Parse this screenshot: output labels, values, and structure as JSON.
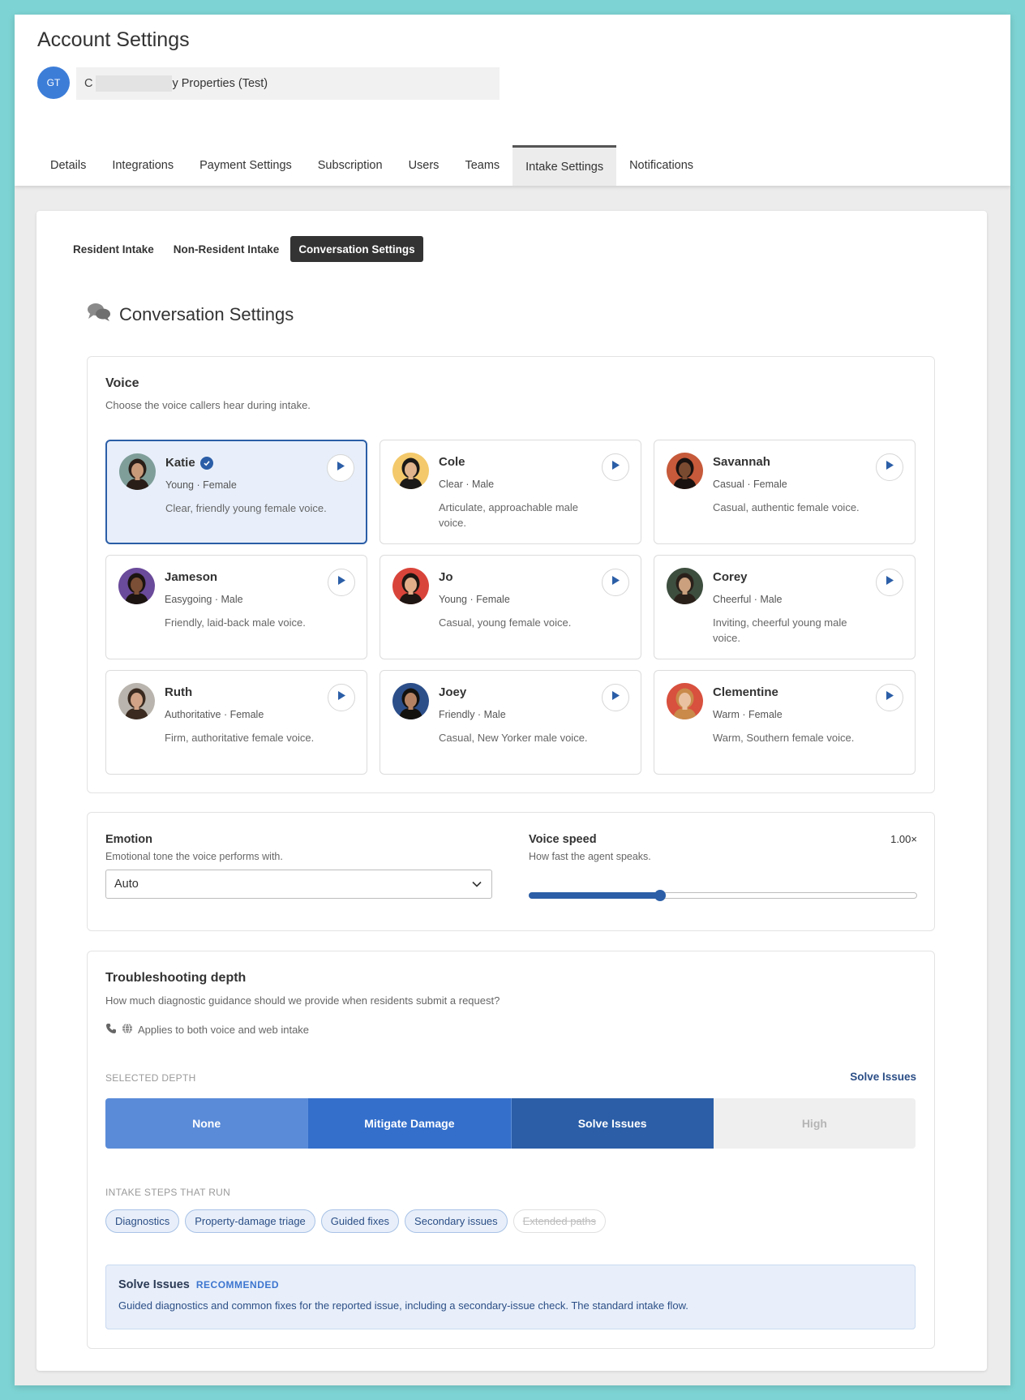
{
  "header": {
    "title": "Account Settings",
    "avatar_initials": "GT",
    "account_prefix": "C",
    "account_suffix": "y Properties (Test)"
  },
  "tabs": [
    {
      "label": "Details"
    },
    {
      "label": "Integrations"
    },
    {
      "label": "Payment Settings"
    },
    {
      "label": "Subscription"
    },
    {
      "label": "Users"
    },
    {
      "label": "Teams"
    },
    {
      "label": "Intake Settings",
      "active": true
    },
    {
      "label": "Notifications"
    }
  ],
  "subtabs": [
    {
      "label": "Resident Intake"
    },
    {
      "label": "Non-Resident Intake"
    },
    {
      "label": "Conversation Settings",
      "active": true
    }
  ],
  "section": {
    "title": "Conversation Settings",
    "icon": "chat-bubbles-icon"
  },
  "voice": {
    "title": "Voice",
    "subtitle": "Choose the voice callers hear during intake.",
    "selected": "Katie",
    "voices": [
      {
        "name": "Katie",
        "meta": "Young · Female",
        "desc": "Clear, friendly young female voice.",
        "skin": "#c99a7a",
        "hair": "#2a1e18",
        "bg": "#7f9e9a"
      },
      {
        "name": "Cole",
        "meta": "Clear · Male",
        "desc": "Articulate, approachable male voice.",
        "skin": "#e0b48c",
        "hair": "#1c1a18",
        "bg": "#f3c96b"
      },
      {
        "name": "Savannah",
        "meta": "Casual · Female",
        "desc": "Casual, authentic female voice.",
        "skin": "#7a4a30",
        "hair": "#1a1210",
        "bg": "#c65a3a"
      },
      {
        "name": "Jameson",
        "meta": "Easygoing · Male",
        "desc": "Friendly, laid-back male voice.",
        "skin": "#7b4f35",
        "hair": "#1b1410",
        "bg": "#6a4a9a"
      },
      {
        "name": "Jo",
        "meta": "Young · Female",
        "desc": "Casual, young female voice.",
        "skin": "#e2ae8a",
        "hair": "#1e1612",
        "bg": "#d9443a"
      },
      {
        "name": "Corey",
        "meta": "Cheerful · Male",
        "desc": "Inviting, cheerful young male voice.",
        "skin": "#caa07e",
        "hair": "#2a201a",
        "bg": "#3d4e3f"
      },
      {
        "name": "Ruth",
        "meta": "Authoritative · Female",
        "desc": "Firm, authoritative female voice.",
        "skin": "#d2a386",
        "hair": "#3a2a20",
        "bg": "#b9b4ad"
      },
      {
        "name": "Joey",
        "meta": "Friendly · Male",
        "desc": "Casual, New Yorker male voice.",
        "skin": "#b58363",
        "hair": "#14120f",
        "bg": "#2c4f8a"
      },
      {
        "name": "Clementine",
        "meta": "Warm · Female",
        "desc": "Warm, Southern female voice.",
        "skin": "#eac2a2",
        "hair": "#c98a4a",
        "bg": "#d8503e"
      }
    ]
  },
  "emotion": {
    "title": "Emotion",
    "subtitle": "Emotional tone the voice performs with.",
    "value": "Auto"
  },
  "speed": {
    "title": "Voice speed",
    "subtitle": "How fast the agent speaks.",
    "value_label": "1.00×",
    "fraction": 0.338
  },
  "troubleshooting": {
    "title": "Troubleshooting depth",
    "subtitle": "How much diagnostic guidance should we provide when residents submit a request?",
    "applies": "Applies to both voice and web intake",
    "selected_label": "SELECTED DEPTH",
    "selected_value": "Solve Issues",
    "levels": [
      "None",
      "Mitigate Damage",
      "Solve Issues",
      "High"
    ],
    "steps_label": "INTAKE STEPS THAT RUN",
    "steps": [
      {
        "label": "Diagnostics",
        "on": true
      },
      {
        "label": "Property-damage triage",
        "on": true
      },
      {
        "label": "Guided fixes",
        "on": true
      },
      {
        "label": "Secondary issues",
        "on": true
      },
      {
        "label": "Extended paths",
        "on": false
      }
    ],
    "recommendation": {
      "title": "Solve Issues",
      "badge": "RECOMMENDED",
      "desc": "Guided diagnostics and common fixes for the reported issue, including a secondary-issue check. The standard intake flow."
    }
  },
  "colors": {
    "accent": "#2b5ea7",
    "avatar": "#3c7dd8",
    "background": "#7dd3d3"
  }
}
